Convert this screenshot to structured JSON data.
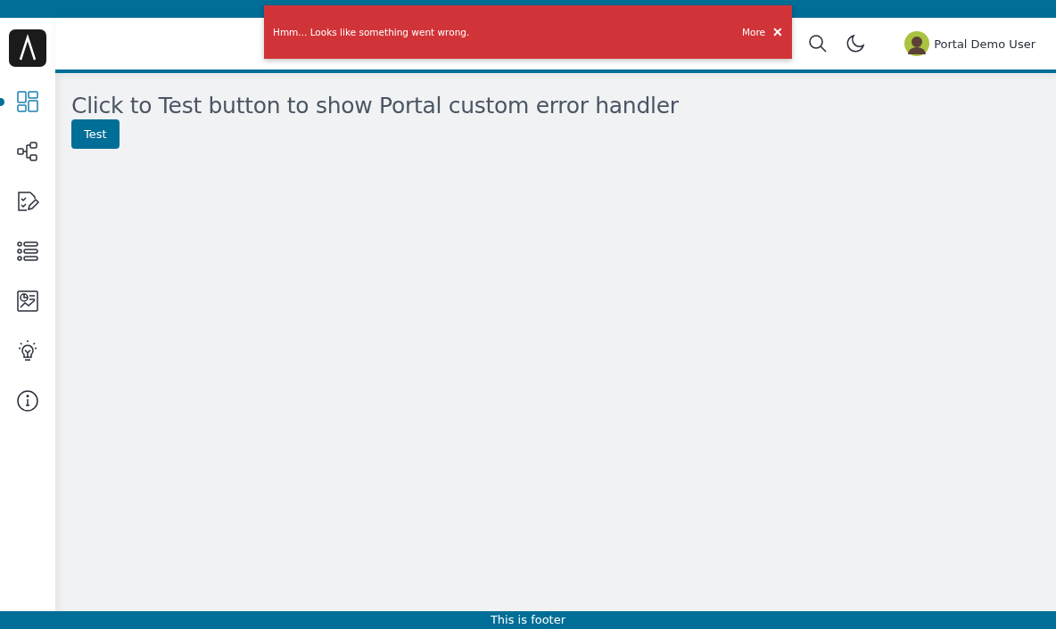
{
  "toast": {
    "message": "Hmm... Looks like something went wrong.",
    "action": "More",
    "close": "✕"
  },
  "header": {
    "user": {
      "name": "Portal Demo User"
    }
  },
  "sidebar": {
    "items": [
      {
        "kind": "dashboard",
        "selected": true
      },
      {
        "kind": "process",
        "selected": false
      },
      {
        "kind": "tasks",
        "selected": false
      },
      {
        "kind": "list",
        "selected": false
      },
      {
        "kind": "statistics",
        "selected": false
      },
      {
        "kind": "idea",
        "selected": false
      },
      {
        "kind": "info",
        "selected": false
      }
    ]
  },
  "content": {
    "heading": "Click to Test button to show Portal custom error handler",
    "button": "Test"
  },
  "footer": {
    "text": "This is footer"
  }
}
